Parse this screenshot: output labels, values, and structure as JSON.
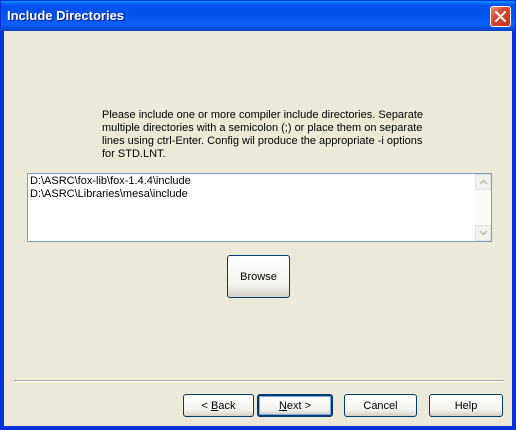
{
  "window": {
    "title": "Include Directories"
  },
  "instructions": "Please include one or more compiler include directories.  Separate\nmultiple directories with a semicolon (;) or place them on separate\nlines using ctrl-Enter.  Config wil produce the appropriate -i options\nfor STD.LNT.",
  "directories": [
    "D:\\ASRC\\fox-lib\\fox-1.4.4\\include",
    "D:\\ASRC\\Libraries\\mesa\\include"
  ],
  "buttons": {
    "browse": "Browse",
    "back_mnemonic": "B",
    "back_rest": "ack",
    "back_prefix": "< ",
    "next_mnemonic": "N",
    "next_rest": "ext >",
    "cancel": "Cancel",
    "help": "Help"
  },
  "icons": {
    "close": "close-icon",
    "scroll_up": "scroll-up-arrow-icon",
    "scroll_down": "scroll-down-arrow-icon"
  }
}
